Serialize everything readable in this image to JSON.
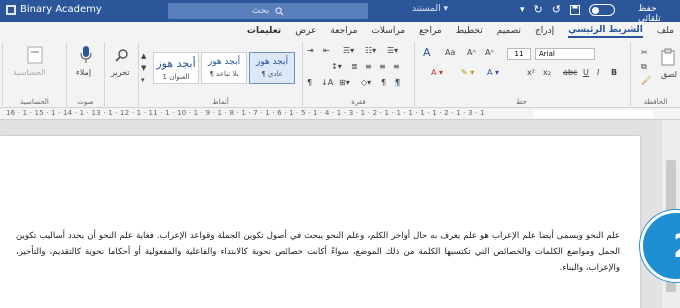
{
  "titlebar": {
    "app_name": "Binary Academy",
    "search_placeholder": "بحث",
    "document": "المستند",
    "autosave": "حفظ تلقائي"
  },
  "tabs": [
    {
      "label": "ملف"
    },
    {
      "label": "الشريط الرئيسي"
    },
    {
      "label": "إدراج"
    },
    {
      "label": "تصميم"
    },
    {
      "label": "تخطيط"
    },
    {
      "label": "مراجع"
    },
    {
      "label": "مراسلات"
    },
    {
      "label": "مراجعة"
    },
    {
      "label": "عرض"
    },
    {
      "label": "تعليمات"
    }
  ],
  "ribbon": {
    "clipboard": {
      "label": "الحافظة",
      "paste": "لصق"
    },
    "font": {
      "label": "خط",
      "font_name": "Arial",
      "font_size": "11"
    },
    "paragraph": {
      "label": "فقرة"
    },
    "styles": {
      "label": "أنماط",
      "items": [
        {
          "sample": "أبجد هوز",
          "name": "¶ عادي"
        },
        {
          "sample": "أبجد هوز",
          "name": "¶ بلا تباعد"
        },
        {
          "sample": "أبجد هوز",
          "name": "العنوان 1"
        }
      ]
    },
    "editing": {
      "label": "تحرير"
    },
    "voice": {
      "label": "صوت",
      "dictate": "إملاء"
    },
    "sensitivity": {
      "label": "الحساسية",
      "button": "الحساسية"
    }
  },
  "ruler": {
    "marks": "16 · 1 · 15 · 1 · 14 · 1 · 13 · 1 · 12 · 1 · 11 · 1 · 10 · 1 · 9 · 1 · 8 · 1 · 7 · 1 · 6 · 1 · 5 · 1 · 4 · 1 · 3 · 1 · 2 · 1 · 1 · 1 · 1 · 1 · 2 · 1 · 3 · 1"
  },
  "document": {
    "paragraph": "علم النحو ويسمى أيضا علم الإعراب هو علم يعرف به حال أواخر الكلم، وعلم النحو يبحث في أصول تكوين الجملة وقواعد الإعراب. فغاية علم النحو أن يحدد أساليب تكوين الجمل ومواضع الكلمات والخصائص التي تكتسبها الكلمة من ذلك الموضع، سواءً أكانت خصائص نحوية كالابتداء والفاعلية والمفعولية أو أحكاما نحوية كالتقديم، والتأخير، والإعراب، والبناء."
  },
  "badge": {
    "number": "2"
  }
}
